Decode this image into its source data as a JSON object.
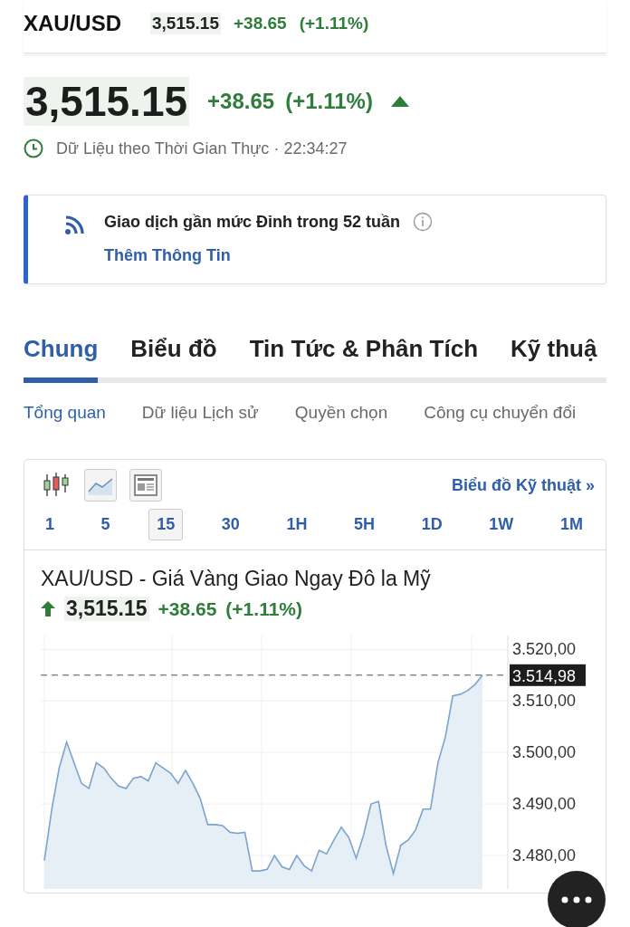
{
  "sticky_header": {
    "symbol": "XAU/USD",
    "price": "3,515.15",
    "change": "+38.65",
    "change_percent": "(+1.11%)"
  },
  "quote": {
    "price": "3,515.15",
    "change": "+38.65",
    "change_percent": "(+1.11%)",
    "realtime_label": "Dữ Liệu theo Thời Gian Thực",
    "separator": "·",
    "time": "22:34:27"
  },
  "alert": {
    "text": "Giao dịch gần mức Đỉnh trong 52 tuần",
    "link": "Thêm Thông Tin"
  },
  "tabs": [
    {
      "label": "Chung",
      "selected": true
    },
    {
      "label": "Biểu đồ",
      "selected": false
    },
    {
      "label": "Tin Tức & Phân Tích",
      "selected": false
    },
    {
      "label": "Kỹ thuậ",
      "selected": false
    }
  ],
  "subtabs": [
    {
      "label": "Tổng quan",
      "selected": true
    },
    {
      "label": "Dữ liệu Lịch sử",
      "selected": false
    },
    {
      "label": "Quyền chọn",
      "selected": false
    },
    {
      "label": "Công cụ chuyển đổi",
      "selected": false
    }
  ],
  "chart_widget": {
    "technical_link": "Biểu đồ Kỹ thuật",
    "link_arrow": "»",
    "intervals": [
      {
        "label": "1",
        "selected": false
      },
      {
        "label": "5",
        "selected": false
      },
      {
        "label": "15",
        "selected": true
      },
      {
        "label": "30",
        "selected": false
      },
      {
        "label": "1H",
        "selected": false
      },
      {
        "label": "5H",
        "selected": false
      },
      {
        "label": "1D",
        "selected": false
      },
      {
        "label": "1W",
        "selected": false
      },
      {
        "label": "1M",
        "selected": false
      }
    ],
    "title": "XAU/USD - Giá Vàng Giao Ngay Đô la Mỹ",
    "price": "3,515.15",
    "change": "+38.65",
    "change_percent": "(+1.11%)",
    "chart_data": {
      "type": "area",
      "grid": true,
      "series": [
        {
          "color": "#7ba3cc",
          "values": [
            3479,
            3489,
            3497,
            3502,
            3498,
            3494,
            3493,
            3498,
            3497,
            3495,
            3493.5,
            3493,
            3495,
            3495.3,
            3494.5,
            3498,
            3497,
            3496,
            3494,
            3496.5,
            3494,
            3491,
            3486,
            3486,
            3485.8,
            3484.5,
            3484.3,
            3484.5,
            3477,
            3477,
            3477.3,
            3480,
            3477.8,
            3477.3,
            3480,
            3478,
            3477,
            3481,
            3480.3,
            3483,
            3485.5,
            3483.5,
            3479.5,
            3484,
            3490,
            3490.5,
            3482,
            3476.5,
            3482,
            3483,
            3485,
            3489,
            3489,
            3498,
            3503,
            3511,
            3511.3,
            3512,
            3513.2,
            3515
          ]
        }
      ],
      "ylim": [
        3473.5,
        3522.7
      ],
      "yticks": [
        {
          "value": 3520,
          "label": "3.520,00"
        },
        {
          "value": 3510,
          "label": "3.510,00"
        },
        {
          "value": 3500,
          "label": "3.500,00"
        },
        {
          "value": 3490,
          "label": "3.490,00"
        },
        {
          "value": 3480,
          "label": "3.480,00"
        }
      ]
    },
    "last_price_label": "3.514,98"
  }
}
